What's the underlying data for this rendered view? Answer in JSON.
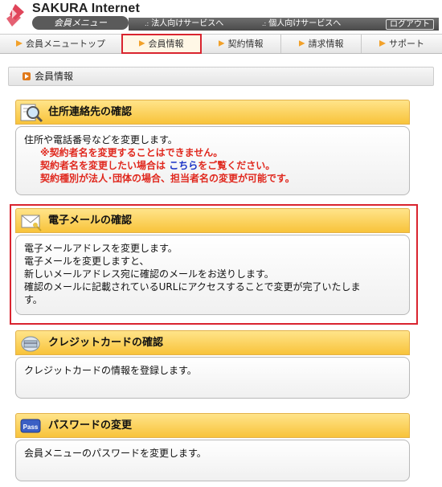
{
  "brand": {
    "name": "SAKURA Internet",
    "subtitle": "会員メニュー"
  },
  "top_links": {
    "corporate": "法人向けサービスへ",
    "personal": "個人向けサービスへ",
    "logout": "ログアウト"
  },
  "nav": [
    {
      "label": "会員メニュートップ",
      "active": false
    },
    {
      "label": "会員情報",
      "active": true
    },
    {
      "label": "契約情報",
      "active": false
    },
    {
      "label": "請求情報",
      "active": false
    },
    {
      "label": "サポート",
      "active": false
    }
  ],
  "page_title": "会員情報",
  "cards": {
    "address": {
      "title": "住所連絡先の確認",
      "line1": "住所や電話番号などを変更します。",
      "warn1": "※契約者名を変更することはできません。",
      "warn2_pre": "契約者名を変更したい場合は",
      "warn2_link": "こちら",
      "warn2_post": "をご覧ください。",
      "warn3": "契約種別が法人･団体の場合、担当者名の変更が可能です。"
    },
    "email": {
      "title": "電子メールの確認",
      "line1": "電子メールアドレスを変更します。",
      "line2": "電子メールを変更しますと、",
      "line3": "新しいメールアドレス宛に確認のメールをお送りします。",
      "line4": "確認のメールに記載されているURLにアクセスすることで変更が完了いたしま",
      "line5": "す。"
    },
    "credit": {
      "title": "クレジットカードの確認",
      "line1": "クレジットカードの情報を登録します。"
    },
    "password": {
      "title": "パスワードの変更",
      "line1": "会員メニューのパスワードを変更します。",
      "icon_text": "Pass"
    }
  },
  "colors": {
    "accent_red": "#d9242f",
    "card_header": "#f8c33a",
    "warning": "#e0291f",
    "link": "#1a33c7"
  }
}
